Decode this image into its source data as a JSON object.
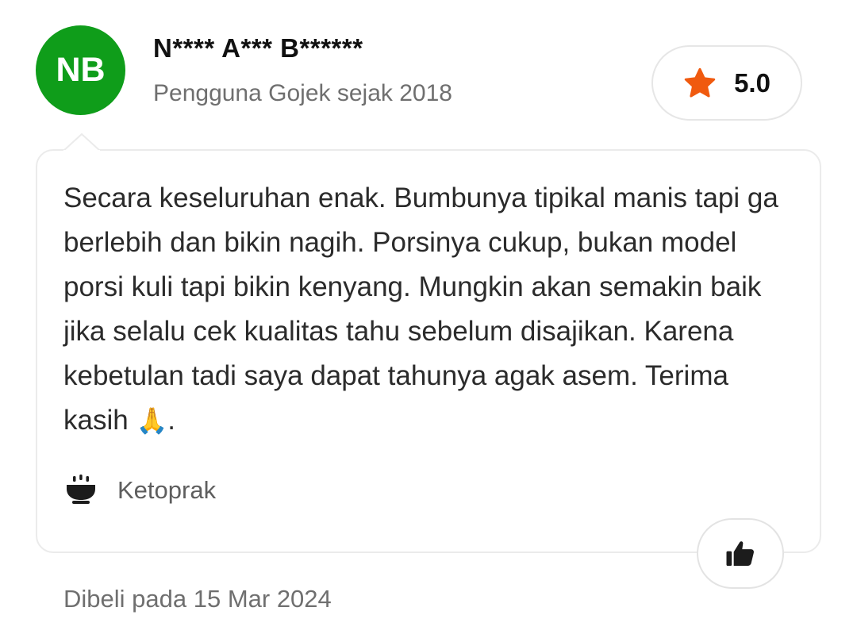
{
  "reviewer": {
    "initials": "NB",
    "name": "N**** A*** B******",
    "since": "Pengguna Gojek sejak 2018",
    "avatar_color": "#0f9d1a"
  },
  "rating": {
    "value": "5.0",
    "icon": "star-icon",
    "star_color": "#f05a0f"
  },
  "review": {
    "text": "Secara keseluruhan enak. Bumbunya tipikal manis tapi ga berlebih dan bikin nagih. Porsinya cukup, bukan model porsi kuli tapi bikin kenyang. Mungkin akan semakin baik jika selalu cek kualitas tahu sebelum disajikan. Karena kebetulan tadi saya dapat tahunya agak asem. Terima kasih",
    "emoji": "🙏",
    "end_punct": "."
  },
  "dish": {
    "icon": "bowl-icon",
    "name": "Ketoprak"
  },
  "like": {
    "icon": "thumbs-up-icon"
  },
  "purchase": {
    "date_text": "Dibeli pada 15 Mar 2024"
  }
}
